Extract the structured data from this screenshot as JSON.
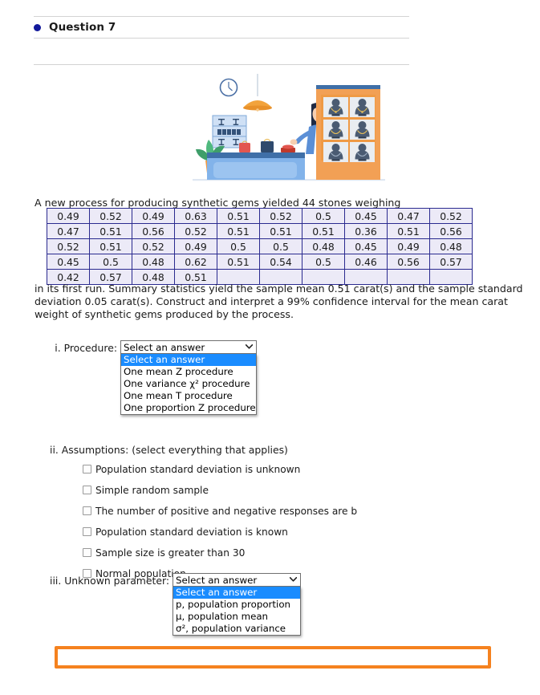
{
  "question": {
    "title": "Question 7",
    "bullet_color": "#12199b"
  },
  "illustration": {
    "name": "jewelry-store-illustration",
    "alt": "Jewelry store clerk behind counter with display case of necklaces, pendant lamp, wall clock and potted plant"
  },
  "prompt": {
    "intro": "A new process for producing synthetic gems yielded 44 stones weighing",
    "outro": "in its first run. Summary statistics yield the sample mean 0.51 carat(s) and the sample standard deviation 0.05 carat(s). Construct and interpret a 99% confidence interval for the mean carat weight of synthetic gems produced by the process."
  },
  "data_table": {
    "rows": [
      [
        "0.49",
        "0.52",
        "0.49",
        "0.63",
        "0.51",
        "0.52",
        "0.5",
        "0.45",
        "0.47",
        "0.52"
      ],
      [
        "0.47",
        "0.51",
        "0.56",
        "0.52",
        "0.51",
        "0.51",
        "0.51",
        "0.36",
        "0.51",
        "0.56"
      ],
      [
        "0.52",
        "0.51",
        "0.52",
        "0.49",
        "0.5",
        "0.5",
        "0.48",
        "0.45",
        "0.49",
        "0.48"
      ],
      [
        "0.45",
        "0.5",
        "0.48",
        "0.62",
        "0.51",
        "0.54",
        "0.5",
        "0.46",
        "0.56",
        "0.57"
      ],
      [
        "0.42",
        "0.57",
        "0.48",
        "0.51",
        "",
        "",
        "",
        "",
        "",
        ""
      ]
    ]
  },
  "part_i": {
    "label": "i. Procedure:",
    "select": {
      "value": "Select an answer",
      "options": [
        "Select an answer",
        "One mean Z procedure",
        "One variance χ² procedure",
        "One mean T procedure",
        "One proportion Z procedure"
      ],
      "selected_index": 0,
      "expanded": true,
      "caret": "⌄"
    }
  },
  "part_ii": {
    "heading": "ii. Assumptions: (select everything that applies)",
    "checkboxes": [
      {
        "label": "Population standard deviation is unknown",
        "checked": false
      },
      {
        "label": "Simple random sample",
        "checked": false
      },
      {
        "label": "The number of positive and negative responses are b",
        "checked": false
      },
      {
        "label": "Population standard deviation is known",
        "checked": false
      },
      {
        "label": "Sample size is greater than 30",
        "checked": false
      },
      {
        "label": "Normal population",
        "checked": false
      }
    ]
  },
  "part_iii": {
    "label": "iii. Unknown parameter:",
    "select": {
      "value": "Select an answer",
      "options": [
        "Select an answer",
        "p, population proportion",
        "μ, population mean",
        "σ², population variance"
      ],
      "selected_index": 0,
      "expanded": true,
      "caret": "⌄"
    }
  },
  "answer_box": {
    "value": "",
    "placeholder": "",
    "border_color": "#f5821f"
  }
}
